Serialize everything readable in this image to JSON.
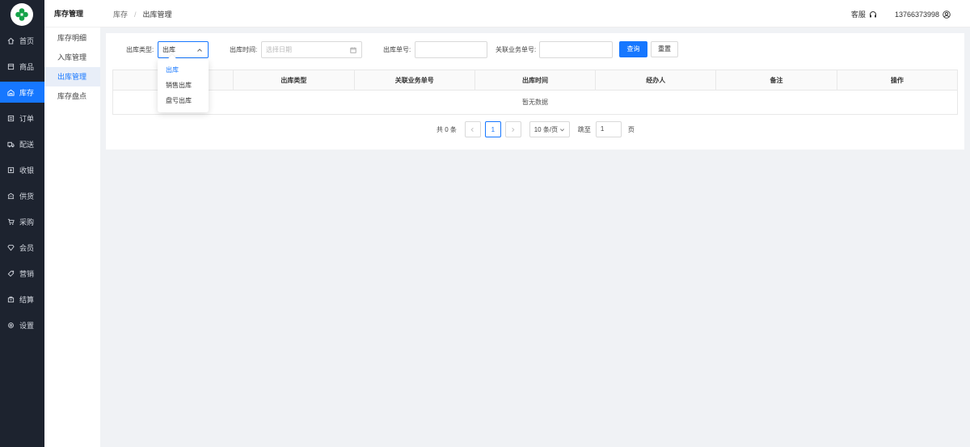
{
  "nav": {
    "items": [
      {
        "label": "首页",
        "icon": "home-icon"
      },
      {
        "label": "商品",
        "icon": "box-icon"
      },
      {
        "label": "库存",
        "icon": "warehouse-icon"
      },
      {
        "label": "订单",
        "icon": "order-icon"
      },
      {
        "label": "配送",
        "icon": "truck-icon"
      },
      {
        "label": "收银",
        "icon": "cashier-icon"
      },
      {
        "label": "供货",
        "icon": "supply-icon"
      },
      {
        "label": "采购",
        "icon": "cart-icon"
      },
      {
        "label": "会员",
        "icon": "member-icon"
      },
      {
        "label": "营销",
        "icon": "tag-icon"
      },
      {
        "label": "结算",
        "icon": "settle-icon"
      },
      {
        "label": "设置",
        "icon": "gear-icon"
      }
    ],
    "active_index": 2,
    "accent": "#1677ff"
  },
  "subnav": {
    "title": "库存管理",
    "items": [
      "库存明细",
      "入库管理",
      "出库管理",
      "库存盘点"
    ],
    "active_index": 2
  },
  "header": {
    "breadcrumb": [
      "库存",
      "出库管理"
    ],
    "service_label": "客服",
    "user": "13766373998"
  },
  "filters": {
    "type_label": "出库类型:",
    "type_value": "出库",
    "time_label": "出库时间:",
    "time_placeholder": "选择日期",
    "order_label": "出库单号:",
    "order_value": "",
    "biz_label": "关联业务单号:",
    "biz_value": "",
    "search_button": "查询",
    "reset_button": "重置"
  },
  "table": {
    "columns": [
      "",
      "出库类型",
      "关联业务单号",
      "出库时间",
      "经办人",
      "备注",
      "操作"
    ],
    "empty_text": "暂无数据"
  },
  "pagination": {
    "total": "共 0 条",
    "current_page": "1",
    "page_size": "10 条/页",
    "jump_label": "跳至",
    "jump_value": "1",
    "page_unit": "页"
  },
  "dropdown": {
    "options": [
      "出库",
      "销售出库",
      "盘亏出库"
    ],
    "selected_index": 0
  }
}
